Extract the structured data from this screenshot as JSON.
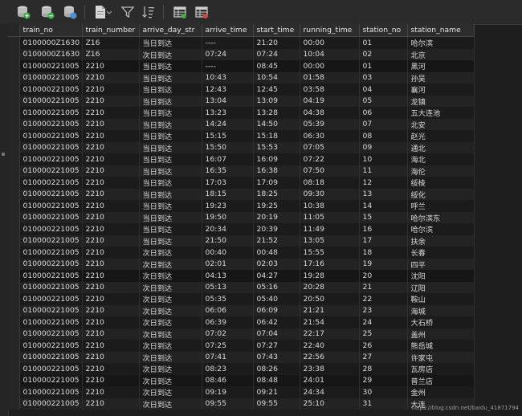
{
  "toolbar": {
    "icons": [
      "add-row-icon",
      "delete-row-icon",
      "refresh-icon",
      "document-icon",
      "filter-icon",
      "sort-icon",
      "grid-view-icon",
      "form-view-icon"
    ],
    "colors": {
      "green": "#3fae49",
      "red": "#d9453d",
      "blue": "#4a8fd8",
      "gray": "#9a9a9a"
    }
  },
  "columns": [
    "train_no",
    "train_number",
    "arrive_day_str",
    "arrive_time",
    "start_time",
    "running_time",
    "station_no",
    "station_name"
  ],
  "rows": [
    [
      "0100000Z1630",
      "Z16",
      "当日到达",
      "----",
      "21:20",
      "00:00",
      "01",
      "哈尔滨"
    ],
    [
      "0100000Z1630",
      "Z16",
      "次日到达",
      "07:24",
      "07:24",
      "10:04",
      "02",
      "北京"
    ],
    [
      "010000221005",
      "2210",
      "当日到达",
      "----",
      "08:45",
      "00:00",
      "01",
      "黑河"
    ],
    [
      "010000221005",
      "2210",
      "当日到达",
      "10:43",
      "10:54",
      "01:58",
      "03",
      "孙吴"
    ],
    [
      "010000221005",
      "2210",
      "当日到达",
      "12:43",
      "12:45",
      "03:58",
      "04",
      "襄河"
    ],
    [
      "010000221005",
      "2210",
      "当日到达",
      "13:04",
      "13:09",
      "04:19",
      "05",
      "龙镇"
    ],
    [
      "010000221005",
      "2210",
      "当日到达",
      "13:23",
      "13:28",
      "04:38",
      "06",
      "五大连池"
    ],
    [
      "010000221005",
      "2210",
      "当日到达",
      "14:24",
      "14:50",
      "05:39",
      "07",
      "北安"
    ],
    [
      "010000221005",
      "2210",
      "当日到达",
      "15:15",
      "15:18",
      "06:30",
      "08",
      "赵光"
    ],
    [
      "010000221005",
      "2210",
      "当日到达",
      "15:50",
      "15:53",
      "07:05",
      "09",
      "通北"
    ],
    [
      "010000221005",
      "2210",
      "当日到达",
      "16:07",
      "16:09",
      "07:22",
      "10",
      "海北"
    ],
    [
      "010000221005",
      "2210",
      "当日到达",
      "16:35",
      "16:38",
      "07:50",
      "11",
      "海伦"
    ],
    [
      "010000221005",
      "2210",
      "当日到达",
      "17:03",
      "17:09",
      "08:18",
      "12",
      "绥棱"
    ],
    [
      "010000221005",
      "2210",
      "当日到达",
      "18:15",
      "18:25",
      "09:30",
      "13",
      "绥化"
    ],
    [
      "010000221005",
      "2210",
      "当日到达",
      "19:23",
      "19:25",
      "10:38",
      "14",
      "呼兰"
    ],
    [
      "010000221005",
      "2210",
      "当日到达",
      "19:50",
      "20:19",
      "11:05",
      "15",
      "哈尔滨东"
    ],
    [
      "010000221005",
      "2210",
      "当日到达",
      "20:34",
      "20:39",
      "11:49",
      "16",
      "哈尔滨"
    ],
    [
      "010000221005",
      "2210",
      "当日到达",
      "21:50",
      "21:52",
      "13:05",
      "17",
      "扶余"
    ],
    [
      "010000221005",
      "2210",
      "次日到达",
      "00:40",
      "00:48",
      "15:55",
      "18",
      "长春"
    ],
    [
      "010000221005",
      "2210",
      "次日到达",
      "02:01",
      "02:03",
      "17:16",
      "19",
      "四平"
    ],
    [
      "010000221005",
      "2210",
      "次日到达",
      "04:13",
      "04:27",
      "19:28",
      "20",
      "沈阳"
    ],
    [
      "010000221005",
      "2210",
      "次日到达",
      "05:13",
      "05:16",
      "20:28",
      "21",
      "辽阳"
    ],
    [
      "010000221005",
      "2210",
      "次日到达",
      "05:35",
      "05:40",
      "20:50",
      "22",
      "鞍山"
    ],
    [
      "010000221005",
      "2210",
      "次日到达",
      "06:06",
      "06:09",
      "21:21",
      "23",
      "海城"
    ],
    [
      "010000221005",
      "2210",
      "次日到达",
      "06:39",
      "06:42",
      "21:54",
      "24",
      "大石桥"
    ],
    [
      "010000221005",
      "2210",
      "次日到达",
      "07:02",
      "07:04",
      "22:17",
      "25",
      "盖州"
    ],
    [
      "010000221005",
      "2210",
      "次日到达",
      "07:25",
      "07:27",
      "22:40",
      "26",
      "熊岳城"
    ],
    [
      "010000221005",
      "2210",
      "次日到达",
      "07:41",
      "07:43",
      "22:56",
      "27",
      "许家屯"
    ],
    [
      "010000221005",
      "2210",
      "次日到达",
      "08:23",
      "08:26",
      "23:38",
      "28",
      "瓦房店"
    ],
    [
      "010000221005",
      "2210",
      "次日到达",
      "08:46",
      "08:48",
      "24:01",
      "29",
      "普兰店"
    ],
    [
      "010000221005",
      "2210",
      "次日到达",
      "09:19",
      "09:21",
      "24:34",
      "30",
      "金州"
    ],
    [
      "010000221005",
      "2210",
      "次日到达",
      "09:55",
      "09:55",
      "25:10",
      "31",
      "大连"
    ]
  ],
  "watermark": "https://blog.csdn.net/baidu_41871794"
}
